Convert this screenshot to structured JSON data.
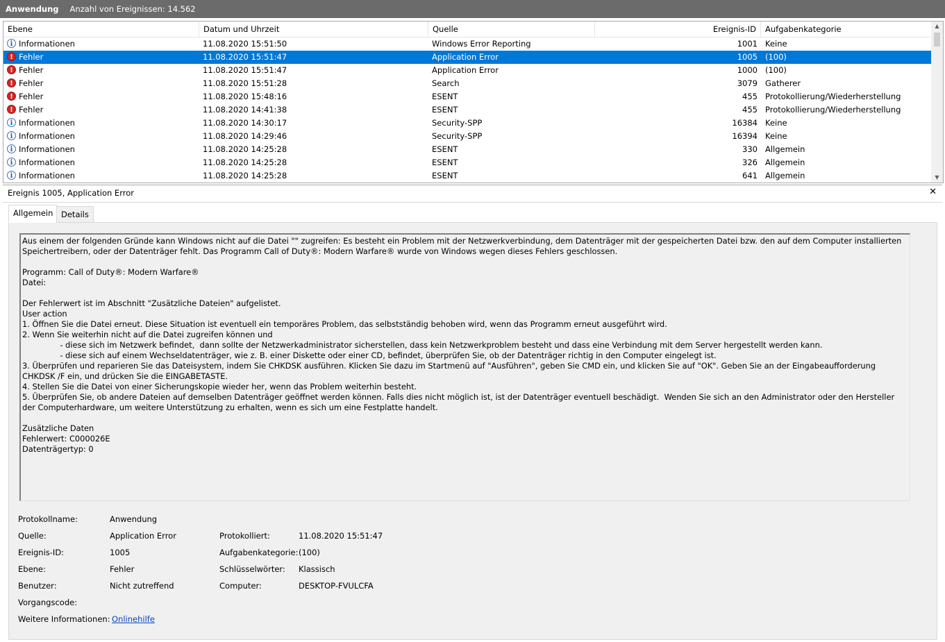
{
  "titlebar": {
    "name": "Anwendung",
    "count": "Anzahl von Ereignissen: 14.562"
  },
  "grid": {
    "headers": {
      "level": "Ebene",
      "date": "Datum und Uhrzeit",
      "source": "Quelle",
      "id": "Ereignis-ID",
      "category": "Aufgabenkategorie"
    },
    "rows": [
      {
        "level": "Informationen",
        "icon": "info-icon",
        "date": "11.08.2020 15:51:50",
        "source": "Windows Error Reporting",
        "id": "1001",
        "category": "Keine",
        "selected": false
      },
      {
        "level": "Fehler",
        "icon": "error-icon",
        "date": "11.08.2020 15:51:47",
        "source": "Application Error",
        "id": "1005",
        "category": "(100)",
        "selected": true
      },
      {
        "level": "Fehler",
        "icon": "error-icon",
        "date": "11.08.2020 15:51:47",
        "source": "Application Error",
        "id": "1000",
        "category": "(100)",
        "selected": false
      },
      {
        "level": "Fehler",
        "icon": "error-icon",
        "date": "11.08.2020 15:51:28",
        "source": "Search",
        "id": "3079",
        "category": "Gatherer",
        "selected": false
      },
      {
        "level": "Fehler",
        "icon": "error-icon",
        "date": "11.08.2020 15:48:16",
        "source": "ESENT",
        "id": "455",
        "category": "Protokollierung/Wiederherstellung",
        "selected": false
      },
      {
        "level": "Fehler",
        "icon": "error-icon",
        "date": "11.08.2020 14:41:38",
        "source": "ESENT",
        "id": "455",
        "category": "Protokollierung/Wiederherstellung",
        "selected": false
      },
      {
        "level": "Informationen",
        "icon": "info-icon",
        "date": "11.08.2020 14:30:17",
        "source": "Security-SPP",
        "id": "16384",
        "category": "Keine",
        "selected": false
      },
      {
        "level": "Informationen",
        "icon": "info-icon",
        "date": "11.08.2020 14:29:46",
        "source": "Security-SPP",
        "id": "16394",
        "category": "Keine",
        "selected": false
      },
      {
        "level": "Informationen",
        "icon": "info-icon",
        "date": "11.08.2020 14:25:28",
        "source": "ESENT",
        "id": "330",
        "category": "Allgemein",
        "selected": false
      },
      {
        "level": "Informationen",
        "icon": "info-icon",
        "date": "11.08.2020 14:25:28",
        "source": "ESENT",
        "id": "326",
        "category": "Allgemein",
        "selected": false
      },
      {
        "level": "Informationen",
        "icon": "info-icon",
        "date": "11.08.2020 14:25:28",
        "source": "ESENT",
        "id": "641",
        "category": "Allgemein",
        "selected": false
      }
    ]
  },
  "detail": {
    "title": "Ereignis 1005, Application Error",
    "close": "✕",
    "tabs": [
      "Allgemein",
      "Details"
    ],
    "description": "Aus einem der folgenden Gründe kann Windows nicht auf die Datei \"\" zugreifen: Es besteht ein Problem mit der Netzwerkverbindung, dem Datenträger mit der gespeicherten Datei bzw. den auf dem Computer installierten Speichertreibern, oder der Datenträger fehlt. Das Programm Call of Duty®: Modern Warfare® wurde von Windows wegen dieses Fehlers geschlossen.\n\nProgramm: Call of Duty®: Modern Warfare®\nDatei: \n\nDer Fehlerwert ist im Abschnitt \"Zusätzliche Dateien\" aufgelistet.\nUser action\n1. Öffnen Sie die Datei erneut. Diese Situation ist eventuell ein temporäres Problem, das selbstständig behoben wird, wenn das Programm erneut ausgeführt wird.\n2. Wenn Sie weiterhin nicht auf die Datei zugreifen können und\n               - diese sich im Netzwerk befindet,  dann sollte der Netzwerkadministrator sicherstellen, dass kein Netzwerkproblem besteht und dass eine Verbindung mit dem Server hergestellt werden kann.\n               - diese sich auf einem Wechseldatenträger, wie z. B. einer Diskette oder einer CD, befindet, überprüfen Sie, ob der Datenträger richtig in den Computer eingelegt ist.\n3. Überprüfen und reparieren Sie das Dateisystem, indem Sie CHKDSK ausführen. Klicken Sie dazu im Startmenü auf \"Ausführen\", geben Sie CMD ein, und klicken Sie auf \"OK\". Geben Sie an der Eingabeaufforderung CHKDSK /F ein, und drücken Sie die EINGABETASTE.\n4. Stellen Sie die Datei von einer Sicherungskopie wieder her, wenn das Problem weiterhin besteht.\n5. Überprüfen Sie, ob andere Dateien auf demselben Datenträger geöffnet werden können. Falls dies nicht möglich ist, ist der Datenträger eventuell beschädigt.  Wenden Sie sich an den Administrator oder den Hersteller der Computerhardware, um weitere Unterstützung zu erhalten, wenn es sich um eine Festplatte handelt.\n\nZusätzliche Daten\nFehlerwert: C000026E\nDatenträgertyp: 0",
    "fields": {
      "log_name_label": "Protokollname:",
      "log_name": "Anwendung",
      "source_label": "Quelle:",
      "source": "Application Error",
      "logged_label": "Protokolliert:",
      "logged": "11.08.2020 15:51:47",
      "event_id_label": "Ereignis-ID:",
      "event_id": "1005",
      "task_category_label": "Aufgabenkategorie:",
      "task_category": "(100)",
      "level_label": "Ebene:",
      "level": "Fehler",
      "keywords_label": "Schlüsselwörter:",
      "keywords": "Klassisch",
      "user_label": "Benutzer:",
      "user": "Nicht zutreffend",
      "computer_label": "Computer:",
      "computer": "DESKTOP-FVULCFA",
      "opcode_label": "Vorgangscode:",
      "more_info_label": "Weitere Informationen:",
      "more_info_link": "Onlinehilfe"
    }
  },
  "colors": {
    "selection": "#0078d7",
    "titlebar": "#6b6b6b",
    "link": "#0645c1"
  }
}
